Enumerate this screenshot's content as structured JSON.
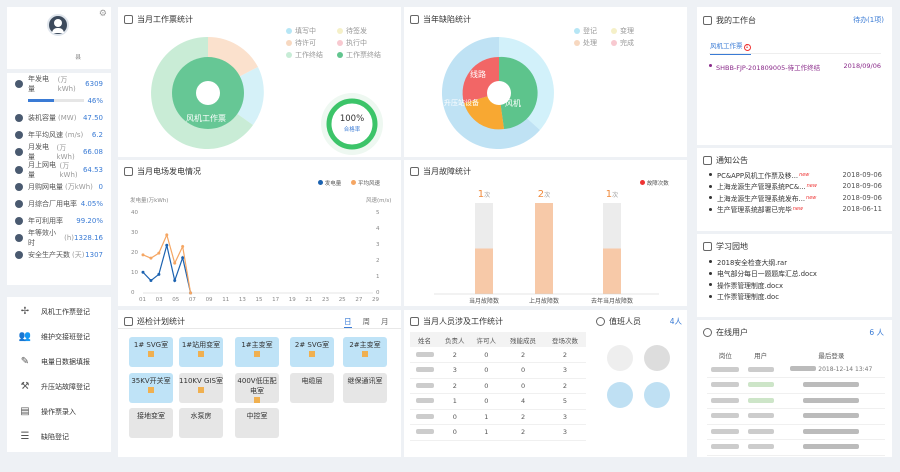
{
  "profile": {
    "name": "                    县"
  },
  "stats": [
    {
      "label": "年发电量",
      "unit": "(万kWh)",
      "value": "6309"
    },
    {
      "label": "",
      "unit": "",
      "value": "46%"
    },
    {
      "label": "装机容量",
      "unit": "(MW)",
      "value": "47.50"
    },
    {
      "label": "年平均风速",
      "unit": "(m/s)",
      "value": "6.2"
    },
    {
      "label": "月发电量",
      "unit": "(万kWh)",
      "value": "66.08"
    },
    {
      "label": "月上网电量",
      "unit": "(万kWh)",
      "value": "64.53"
    },
    {
      "label": "月购网电量",
      "unit": "(万kWh)",
      "value": "0"
    },
    {
      "label": "月综合厂用电率",
      "unit": "",
      "value": "4.05%"
    },
    {
      "label": "年可利用率",
      "unit": "",
      "value": "99.20%"
    },
    {
      "label": "年等效小时",
      "unit": "(h)",
      "value": "1328.16"
    },
    {
      "label": "安全生产天数",
      "unit": "(天)",
      "value": "1307"
    }
  ],
  "nav": [
    {
      "label": "风机工作票登记",
      "icon": "wind-turbine-icon"
    },
    {
      "label": "维护交接班登记",
      "icon": "users-icon"
    },
    {
      "label": "电量日数据填报",
      "icon": "pencil-icon"
    },
    {
      "label": "升压站故障登记",
      "icon": "wrench-icon"
    },
    {
      "label": "操作票录入",
      "icon": "document-icon"
    },
    {
      "label": "缺陷登记",
      "icon": "list-icon"
    }
  ],
  "ticket": {
    "title": "当月工作票统计",
    "legend": [
      "填写中",
      "待签发",
      "待许可",
      "执行中",
      "工作终结",
      "工作票终结"
    ],
    "center": "风机工作票",
    "rate": "100%",
    "rate_label": "合格率"
  },
  "defect": {
    "title": "当年缺陷统计",
    "legend": [
      "登记",
      "变理",
      "处理",
      "完成"
    ],
    "labels": [
      "线路",
      "升压站设备",
      "风机"
    ]
  },
  "power": {
    "title": "当月电场发电情况",
    "legend": [
      "发电量",
      "平均风速"
    ],
    "ylabel_left": "发电量(万kWh)",
    "ylabel_right": "风速(m/s)",
    "xticks": [
      "01",
      "03",
      "05",
      "07",
      "09",
      "11",
      "13",
      "15",
      "17",
      "19",
      "21",
      "23",
      "25",
      "27",
      "29"
    ],
    "yticks_left": [
      "40",
      "30",
      "20",
      "10",
      "0"
    ],
    "yticks_right": [
      "5",
      "4",
      "3",
      "2",
      "1",
      "0"
    ]
  },
  "chart_data": [
    {
      "type": "line",
      "series": [
        {
          "name": "发电量",
          "x": [
            1,
            2,
            3,
            4,
            5,
            6,
            7
          ],
          "values": [
            10,
            6,
            9,
            23,
            6,
            17,
            0
          ]
        },
        {
          "name": "平均风速",
          "x": [
            1,
            2,
            3,
            4,
            5,
            6,
            7
          ],
          "values": [
            2.3,
            2.1,
            2.4,
            3.5,
            1.8,
            2.8,
            0
          ]
        }
      ],
      "xlim": [
        1,
        30
      ],
      "ylim_left": [
        0,
        40
      ],
      "ylim_right": [
        0,
        5
      ]
    },
    {
      "type": "bar",
      "categories": [
        "当月故障数",
        "上月故障数",
        "去年当月故障数"
      ],
      "values": [
        1,
        2,
        1
      ],
      "value_labels": [
        "1",
        "2",
        "1"
      ],
      "unit": "次",
      "legend": "故障次数"
    }
  ],
  "fault": {
    "title": "当月故障统计",
    "legend": "故障次数"
  },
  "patrol": {
    "title": "巡检计划统计",
    "tabs": [
      "日",
      "周",
      "月"
    ],
    "cards": [
      {
        "label": "1# SVG室",
        "lock": true,
        "gray": false
      },
      {
        "label": "1#站用变室",
        "lock": true,
        "gray": false
      },
      {
        "label": "1#主变室",
        "lock": true,
        "gray": false
      },
      {
        "label": "2# SVG室",
        "lock": true,
        "gray": false
      },
      {
        "label": "2#主变室",
        "lock": true,
        "gray": false
      },
      {
        "label": "35KV开关室",
        "lock": true,
        "gray": false
      },
      {
        "label": "110KV GIS室",
        "lock": true,
        "gray": true
      },
      {
        "label": "400V低压配电室",
        "lock": true,
        "gray": true
      },
      {
        "label": "电缆层",
        "lock": false,
        "gray": true
      },
      {
        "label": "继保通讯室",
        "lock": false,
        "gray": true
      },
      {
        "label": "接地变室",
        "lock": false,
        "gray": true
      },
      {
        "label": "水泵房",
        "lock": false,
        "gray": true
      },
      {
        "label": "中控室",
        "lock": false,
        "gray": true
      }
    ]
  },
  "people": {
    "title": "当月人员涉及工作统计",
    "headers": [
      "姓名",
      "负责人",
      "许可人",
      "残能成员",
      "登场次数"
    ],
    "rows": [
      [
        "",
        "2",
        "0",
        "2",
        "2"
      ],
      [
        "",
        "3",
        "0",
        "0",
        "3"
      ],
      [
        "",
        "2",
        "0",
        "0",
        "2"
      ],
      [
        "",
        "1",
        "0",
        "4",
        "5"
      ],
      [
        "",
        "0",
        "1",
        "2",
        "3"
      ],
      [
        "",
        "0",
        "1",
        "2",
        "3"
      ]
    ]
  },
  "duty": {
    "title": "值班人员",
    "count": "4人"
  },
  "workbench": {
    "title": "我的工作台",
    "pending": "待办(1项)",
    "tab": "风机工作票",
    "tab_badge": "1",
    "items": [
      {
        "text": "SHBB-FJP-201809005-待工作终结",
        "date": "2018/09/06"
      }
    ]
  },
  "notice": {
    "title": "通知公告",
    "items": [
      {
        "text": "PC&APP风机工作票及移...",
        "date": "2018-09-06"
      },
      {
        "text": "上海龙源生产管理系统PC&...",
        "date": "2018-09-06"
      },
      {
        "text": "上海龙源生产管理系统发布...",
        "date": "2018-09-06"
      },
      {
        "text": "生产管理系统部署已完毕",
        "date": "2018-06-11"
      }
    ]
  },
  "study": {
    "title": "学习园地",
    "items": [
      "2018安全检查大纲.rar",
      "电气部分每日一题题库汇总.docx",
      "操作票管理制度.docx",
      "工作票管理制度.doc"
    ]
  },
  "online": {
    "title": "在线用户",
    "count": "6 人",
    "headers": [
      "岗位",
      "用户",
      "最后登录"
    ],
    "rows": [
      {
        "last": "2018-12-14 13:47"
      }
    ]
  }
}
